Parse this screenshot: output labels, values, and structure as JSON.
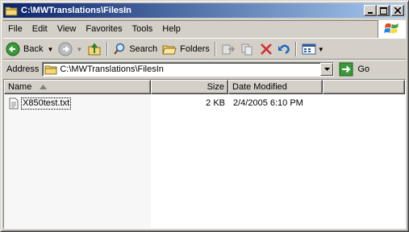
{
  "window": {
    "title": "C:\\MWTranslations\\FilesIn"
  },
  "menu": {
    "items": [
      {
        "label": "File"
      },
      {
        "label": "Edit"
      },
      {
        "label": "View"
      },
      {
        "label": "Favorites"
      },
      {
        "label": "Tools"
      },
      {
        "label": "Help"
      }
    ]
  },
  "toolbar": {
    "back_label": "Back",
    "search_label": "Search",
    "folders_label": "Folders"
  },
  "address": {
    "label": "Address",
    "value": "C:\\MWTranslations\\FilesIn",
    "go_label": "Go"
  },
  "list": {
    "columns": {
      "name": "Name",
      "size": "Size",
      "date": "Date Modified"
    },
    "rows": [
      {
        "name": "X850test.txt",
        "size": "2 KB",
        "date": "2/4/2005 6:10 PM"
      }
    ]
  },
  "colors": {
    "titlebar_start": "#0a246a",
    "titlebar_end": "#a6caf0",
    "chrome": "#d4d0c8"
  }
}
